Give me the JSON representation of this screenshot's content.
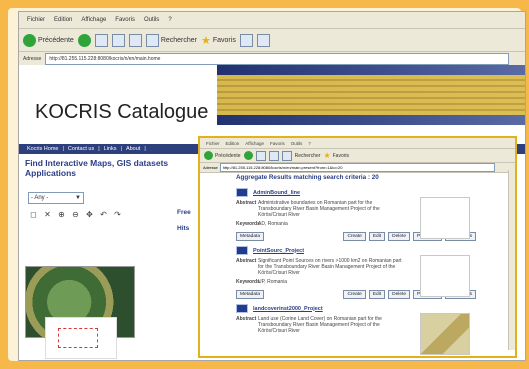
{
  "browser": {
    "menus": [
      "Fichier",
      "Edition",
      "Affichage",
      "Favoris",
      "Outils",
      "?"
    ],
    "toolbar": {
      "back": "Précédente",
      "search": "Rechercher",
      "favorites": "Favoris"
    },
    "address": {
      "label": "Adresse",
      "url": "http://81.255.115.228:8080/kocris/n/en/main.home"
    }
  },
  "site": {
    "title": "KOCRIS Catalogue",
    "nav_links": [
      "Kocris Home",
      "Contact us",
      "Links",
      "About"
    ],
    "heading": "Find Interactive Maps, GIS datasets Applications",
    "area_select": "- Any -",
    "labels": [
      "Free",
      "Hits"
    ]
  },
  "popup": {
    "menus": [
      "Fichier",
      "Edition",
      "Affichage",
      "Favoris",
      "Outils",
      "?"
    ],
    "toolbar": {
      "back": "Précédente",
      "search": "Rechercher",
      "favorites": "Favoris"
    },
    "address": {
      "label": "Adresse",
      "url": "http://81.255.115.228:8080/kocris/n/en/main.present?from=1&to=20"
    },
    "summary": "Aggregate Results matching search criteria :  20",
    "items": [
      {
        "title": "AdminBound_line",
        "abstract_label": "Abstract",
        "abstract": "Administrative boundaries on Romanian part for the Transboundary River Basin Management Project of the Körös/Crisuri River",
        "keywords_label": "Keywords",
        "keywords": "AD, Romania",
        "metadata_button": "Metadata",
        "actions": [
          "Create",
          "Edit",
          "Delete",
          "Privileges",
          "Categories"
        ]
      },
      {
        "title": "PointSourc_Project",
        "abstract_label": "Abstract",
        "abstract": "Significant Point Sources on rivers >1000 km2 on Romanian part for the Transboundary River Basin Management Project of the Körös/Crisuri River",
        "keywords_label": "Keywords",
        "keywords": "UP, Romania",
        "metadata_button": "Metadata",
        "actions": [
          "Create",
          "Edit",
          "Delete",
          "Privileges",
          "Categories"
        ]
      },
      {
        "title": "landcoverinst2000_Project",
        "abstract_label": "Abstract",
        "abstract": "Land use (Corine Land Cover) on Romanian part for the Transboundary River Basin Management Project of the Körös/Crisuri River",
        "keywords_label": "",
        "keywords": "",
        "metadata_button": "",
        "actions": []
      }
    ]
  }
}
